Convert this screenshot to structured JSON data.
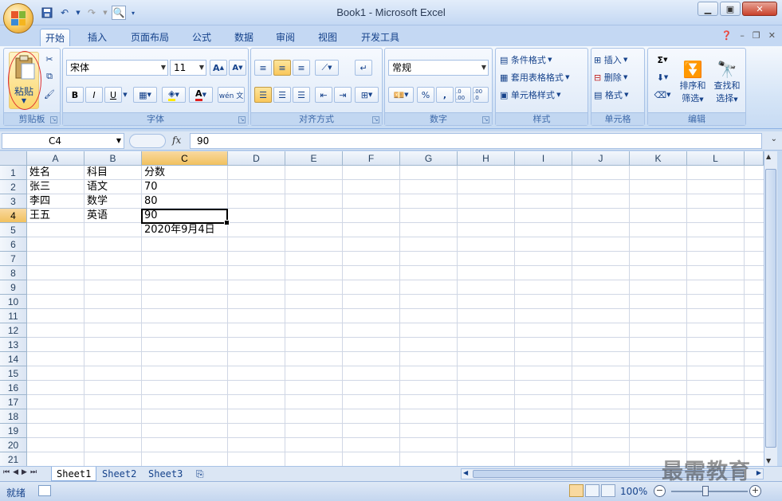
{
  "window": {
    "title": "Book1 - Microsoft Excel"
  },
  "quick_access": {
    "icons": [
      "save-icon",
      "undo-icon",
      "redo-icon",
      "print-preview-icon"
    ]
  },
  "tabs": [
    "开始",
    "插入",
    "页面布局",
    "公式",
    "数据",
    "审阅",
    "视图",
    "开发工具"
  ],
  "active_tab": "开始",
  "ribbon": {
    "clipboard": {
      "label": "剪贴板",
      "paste": "粘贴"
    },
    "font": {
      "label": "字体",
      "name": "宋体",
      "size": "11",
      "bold": "B",
      "italic": "I",
      "underline": "U",
      "font_color_letter": "A",
      "phonetic": "wén 文"
    },
    "alignment": {
      "label": "对齐方式"
    },
    "number": {
      "label": "数字",
      "format": "常规",
      "percent": "%",
      "comma": ",",
      "inc_decimal": ".0 .00",
      "dec_decimal": ".00 .0"
    },
    "styles": {
      "label": "样式",
      "conditional": "条件格式",
      "table": "套用表格格式",
      "cell": "单元格样式"
    },
    "cells": {
      "label": "单元格",
      "insert": "插入",
      "delete": "删除",
      "format": "格式"
    },
    "editing": {
      "label": "编辑",
      "sort_filter_1": "排序和",
      "sort_filter_2": "筛选",
      "find_select_1": "查找和",
      "find_select_2": "选择",
      "sum": "Σ"
    }
  },
  "formula_bar": {
    "name_box": "C4",
    "fx": "fx",
    "value": "90"
  },
  "grid": {
    "columns": [
      "A",
      "B",
      "C",
      "D",
      "E",
      "F",
      "G",
      "H",
      "I",
      "J",
      "K",
      "L"
    ],
    "rows": [
      "1",
      "2",
      "3",
      "4",
      "5",
      "6",
      "7",
      "8",
      "9",
      "10",
      "11",
      "12",
      "13",
      "14",
      "15",
      "16",
      "17",
      "18",
      "19",
      "20",
      "21"
    ],
    "active_column": "C",
    "active_row": "4",
    "cells": {
      "A1": "姓名",
      "B1": "科目",
      "C1": "分数",
      "A2": "张三",
      "B2": "语文",
      "C2": "70",
      "A3": "李四",
      "B3": "数学",
      "C3": "80",
      "A4": "王五",
      "B4": "英语",
      "C4": "90",
      "C5": "2020年9月4日"
    }
  },
  "sheet_tabs": [
    "Sheet1",
    "Sheet2",
    "Sheet3"
  ],
  "active_sheet": "Sheet1",
  "status": {
    "ready": "就绪",
    "zoom": "100%",
    "minus": "−",
    "plus": "+"
  },
  "watermark": "最需教育"
}
